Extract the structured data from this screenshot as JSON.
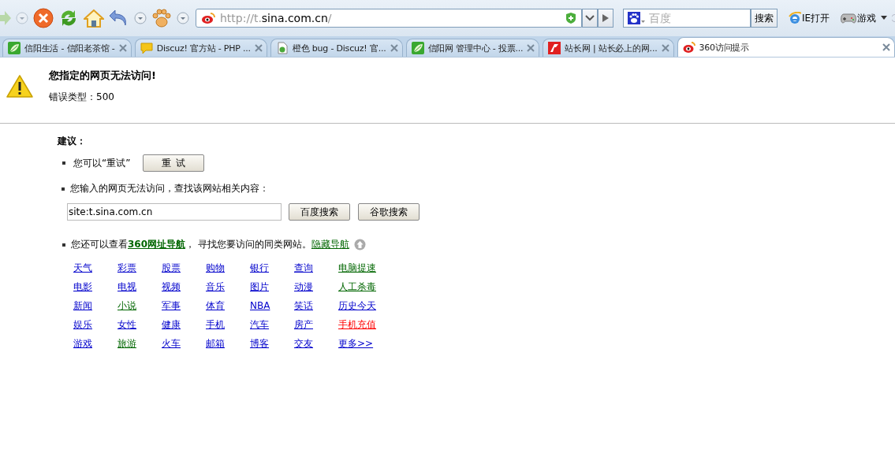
{
  "toolbar": {
    "address": {
      "parts": [
        {
          "text": "http://t.",
          "dim": true
        },
        {
          "text": "sina.com.cn",
          "dim": false
        },
        {
          "text": "/",
          "dim": true
        }
      ]
    },
    "search": {
      "placeholder": "百度",
      "button": "搜索"
    },
    "links": [
      {
        "kind": "ie",
        "label": "IE打开"
      },
      {
        "kind": "game",
        "label": "游戏"
      }
    ]
  },
  "tabs": [
    {
      "title": "信阳生活 - 信阳老茶馆 -",
      "kind": "leaf",
      "selected": false
    },
    {
      "title": "Discuz! 官方站 - PHP ...",
      "kind": "bubble",
      "selected": false
    },
    {
      "title": "橙色 bug - Discuz! 官...",
      "kind": "page",
      "selected": false
    },
    {
      "title": "信阳网 管理中心 - 投票...",
      "kind": "leaf",
      "selected": false
    },
    {
      "title": "站长网 | 站长必上的网...",
      "kind": "logo",
      "selected": false
    },
    {
      "title": "360访问提示",
      "kind": "weibo",
      "selected": true
    }
  ],
  "error": {
    "title": "您指定的网页无法访问!",
    "type_label": "错误类型：",
    "type_value": "500"
  },
  "suggestions": {
    "heading": "建议：",
    "retry_text": "您可以“重试”",
    "retry_button": "重 试",
    "search_text": "您输入的网页无法访问，查找该网站相关内容：",
    "search_value": "site:t.sina.com.cn",
    "search_buttons": [
      "百度搜索",
      "谷歌搜索"
    ],
    "nav_text_before": "您还可以查看",
    "nav_link": "360网址导航",
    "nav_text_after": "， 寻找您要访问的同类网站。",
    "hide_link": "隐藏导航"
  },
  "nav_links": [
    {
      "label": "天气",
      "color": "#0000cc"
    },
    {
      "label": "彩票",
      "color": "#0000cc"
    },
    {
      "label": "股票",
      "color": "#0000cc"
    },
    {
      "label": "购物",
      "color": "#0000cc"
    },
    {
      "label": "银行",
      "color": "#0000cc"
    },
    {
      "label": "查询",
      "color": "#0000cc"
    },
    {
      "label": "电脑提速",
      "color": "#006600"
    },
    {
      "label": "电影",
      "color": "#0000cc"
    },
    {
      "label": "电视",
      "color": "#0000cc"
    },
    {
      "label": "视频",
      "color": "#0000cc"
    },
    {
      "label": "音乐",
      "color": "#0000cc"
    },
    {
      "label": "图片",
      "color": "#0000cc"
    },
    {
      "label": "动漫",
      "color": "#0000cc"
    },
    {
      "label": "人工杀毒",
      "color": "#006600"
    },
    {
      "label": "新闻",
      "color": "#0000cc"
    },
    {
      "label": "小说",
      "color": "#006600"
    },
    {
      "label": "军事",
      "color": "#0000cc"
    },
    {
      "label": "体育",
      "color": "#0000cc"
    },
    {
      "label": "NBA",
      "color": "#0000cc"
    },
    {
      "label": "笑话",
      "color": "#0000cc"
    },
    {
      "label": "历史今天",
      "color": "#0000cc"
    },
    {
      "label": "娱乐",
      "color": "#0000cc"
    },
    {
      "label": "女性",
      "color": "#0000cc"
    },
    {
      "label": "健康",
      "color": "#0000cc"
    },
    {
      "label": "手机",
      "color": "#0000cc"
    },
    {
      "label": "汽车",
      "color": "#0000cc"
    },
    {
      "label": "房产",
      "color": "#0000cc"
    },
    {
      "label": "手机充值",
      "color": "#ff0000"
    },
    {
      "label": "游戏",
      "color": "#0000cc"
    },
    {
      "label": "旅游",
      "color": "#006600"
    },
    {
      "label": "火车",
      "color": "#0000cc"
    },
    {
      "label": "邮箱",
      "color": "#0000cc"
    },
    {
      "label": "博客",
      "color": "#0000cc"
    },
    {
      "label": "交友",
      "color": "#0000cc"
    },
    {
      "label": "更多>>",
      "color": "#0000cc"
    }
  ]
}
